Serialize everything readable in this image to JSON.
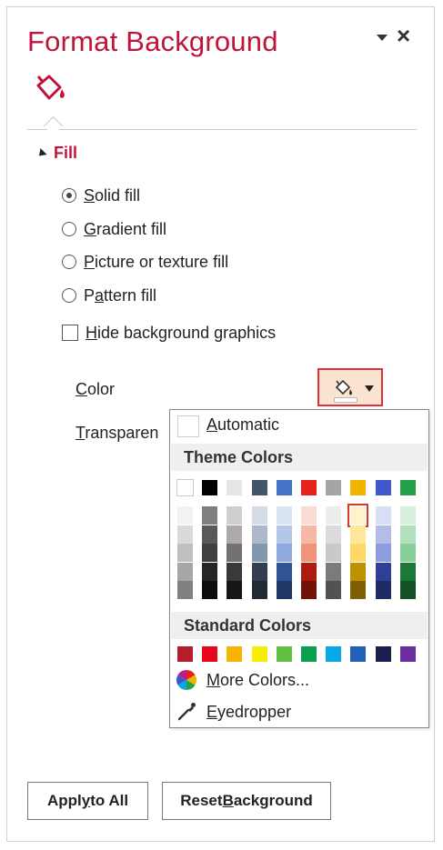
{
  "pane": {
    "title": "Format Background",
    "section": "Fill"
  },
  "fill_options": [
    {
      "label_pre": "",
      "label_key": "S",
      "label_post": "olid fill",
      "selected": true
    },
    {
      "label_pre": "",
      "label_key": "G",
      "label_post": "radient fill",
      "selected": false
    },
    {
      "label_pre": "",
      "label_key": "P",
      "label_post": "icture or texture fill",
      "selected": false
    },
    {
      "label_pre": "P",
      "label_key": "a",
      "label_post": "ttern fill",
      "selected": false
    }
  ],
  "hide_graphics": {
    "label_key": "H",
    "label_post": "ide background graphics",
    "checked": false
  },
  "color": {
    "label_key": "C",
    "label_post": "olor",
    "current": "#ffffff"
  },
  "transparency": {
    "label_key": "T",
    "label_post": "ransparen"
  },
  "color_menu": {
    "automatic_key": "A",
    "automatic_post": "utomatic",
    "theme_header": "Theme Colors",
    "standard_header": "Standard Colors",
    "more_key": "M",
    "more_post": "ore Colors...",
    "eyedropper_key": "E",
    "eyedropper_post": "yedropper",
    "theme_top": [
      "#ffffff",
      "#000000",
      "#e7e6e6",
      "#44546a",
      "#4472c4",
      "#e7211d",
      "#a5a5a5",
      "#f0b400",
      "#3f57ca",
      "#24a148"
    ],
    "theme_shades": [
      [
        "#f2f2f2",
        "#d9d9d9",
        "#bfbfbf",
        "#a6a6a6",
        "#808080"
      ],
      [
        "#7f7f7f",
        "#595959",
        "#404040",
        "#262626",
        "#0d0d0d"
      ],
      [
        "#d0cece",
        "#aeaaaa",
        "#767171",
        "#3a3838",
        "#171616"
      ],
      [
        "#d6dce4",
        "#adb9ca",
        "#8497b0",
        "#323f4f",
        "#222a35"
      ],
      [
        "#dae3f3",
        "#b4c7e7",
        "#8faadc",
        "#2f5597",
        "#203864"
      ],
      [
        "#fadbd2",
        "#f6b7a5",
        "#f09479",
        "#ad1b13",
        "#731208"
      ],
      [
        "#ededed",
        "#dbdbdb",
        "#c9c9c9",
        "#7b7b7b",
        "#525252"
      ],
      [
        "#fff2cc",
        "#ffe699",
        "#ffd966",
        "#bf9000",
        "#7f6000"
      ],
      [
        "#d9def4",
        "#b4bde9",
        "#8e9dde",
        "#2e3f9a",
        "#1f2a66"
      ],
      [
        "#d7efdd",
        "#b0e0bc",
        "#88d09a",
        "#1b7936",
        "#125124"
      ]
    ],
    "standard": [
      "#b51d2c",
      "#e8071c",
      "#f7b400",
      "#f7ef00",
      "#62c043",
      "#0aa04e",
      "#06a9e4",
      "#225fb6",
      "#1b1e4f",
      "#6a2ca1"
    ],
    "selected_theme_index": [
      7,
      0
    ]
  },
  "buttons": {
    "apply_pre": "Appl",
    "apply_key": "y",
    "apply_post": " to All",
    "reset_pre": "Reset ",
    "reset_key": "B",
    "reset_post": "ackground"
  }
}
